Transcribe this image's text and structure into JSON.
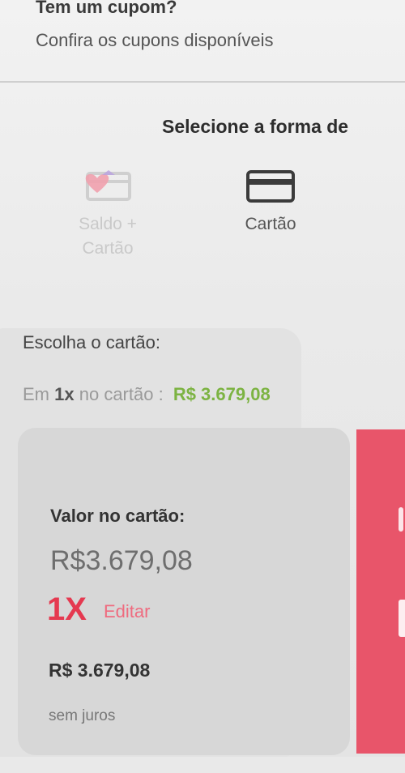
{
  "coupon": {
    "title": "Tem um cupom?",
    "subtitle": "Confira os cupons disponíveis"
  },
  "payment": {
    "section_title": "Selecione a forma de",
    "methods": [
      {
        "label_line1": "Saldo +",
        "label_line2": "Cartão",
        "icon": "balance-card-icon",
        "state": "disabled"
      },
      {
        "label": "Cartão",
        "icon": "credit-card-icon",
        "state": "active"
      }
    ]
  },
  "card_choice": {
    "title": "Escolha o cartão:",
    "installment_prefix": "Em",
    "installment_count": "1x",
    "installment_suffix": "no cartão :",
    "installment_price": "R$  3.679,08"
  },
  "value_card": {
    "label": "Valor no cartão:",
    "amount": "R$3.679,08",
    "installments": "1X",
    "edit_label": "Editar",
    "total": "R$  3.679,08",
    "note": "sem juros"
  },
  "colors": {
    "accent_red": "#e53950",
    "price_green": "#7cb342",
    "side_card": "#e8556a"
  }
}
